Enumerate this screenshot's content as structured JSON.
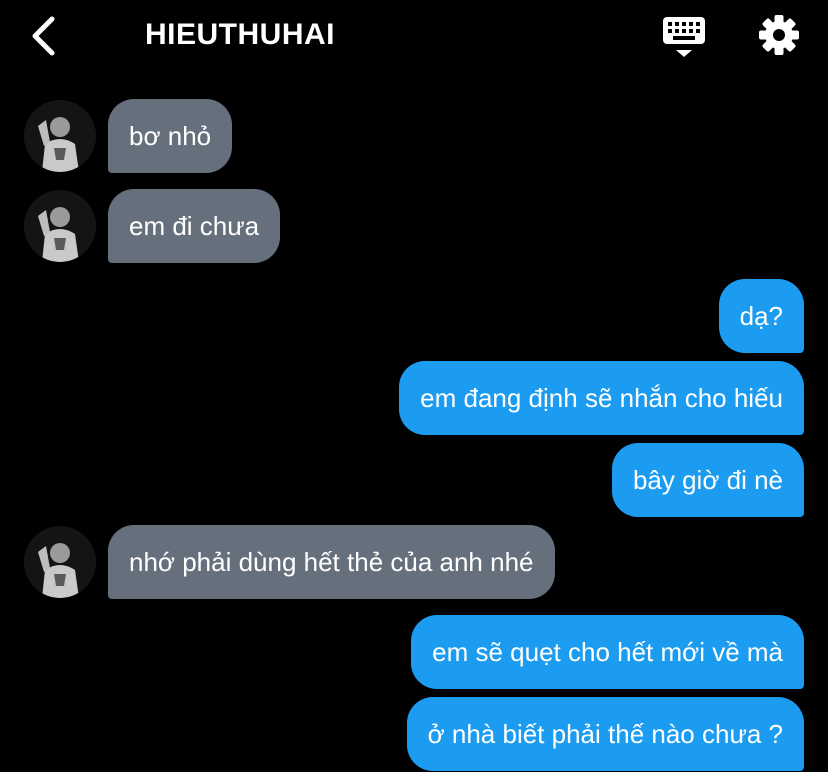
{
  "header": {
    "title": "HIEUTHUHAI",
    "back_icon": "chevron-left-icon",
    "keyboard_icon": "keyboard-icon",
    "settings_icon": "gear-icon"
  },
  "colors": {
    "background": "#000000",
    "incoming_bubble": "#66707d",
    "outgoing_bubble": "#1c9cf0",
    "text": "#ffffff"
  },
  "messages": [
    {
      "from": "contact",
      "text": "bơ nhỏ"
    },
    {
      "from": "contact",
      "text": "em đi chưa"
    },
    {
      "from": "me",
      "text": "dạ?"
    },
    {
      "from": "me",
      "text": "em đang định sẽ nhắn cho hiếu"
    },
    {
      "from": "me",
      "text": "bây giờ đi nè"
    },
    {
      "from": "contact",
      "text": "nhớ phải dùng hết thẻ của anh nhé"
    },
    {
      "from": "me",
      "text": "em sẽ quẹt cho hết mới về mà"
    },
    {
      "from": "me",
      "text": "ở nhà biết phải thế nào chưa ?"
    }
  ]
}
